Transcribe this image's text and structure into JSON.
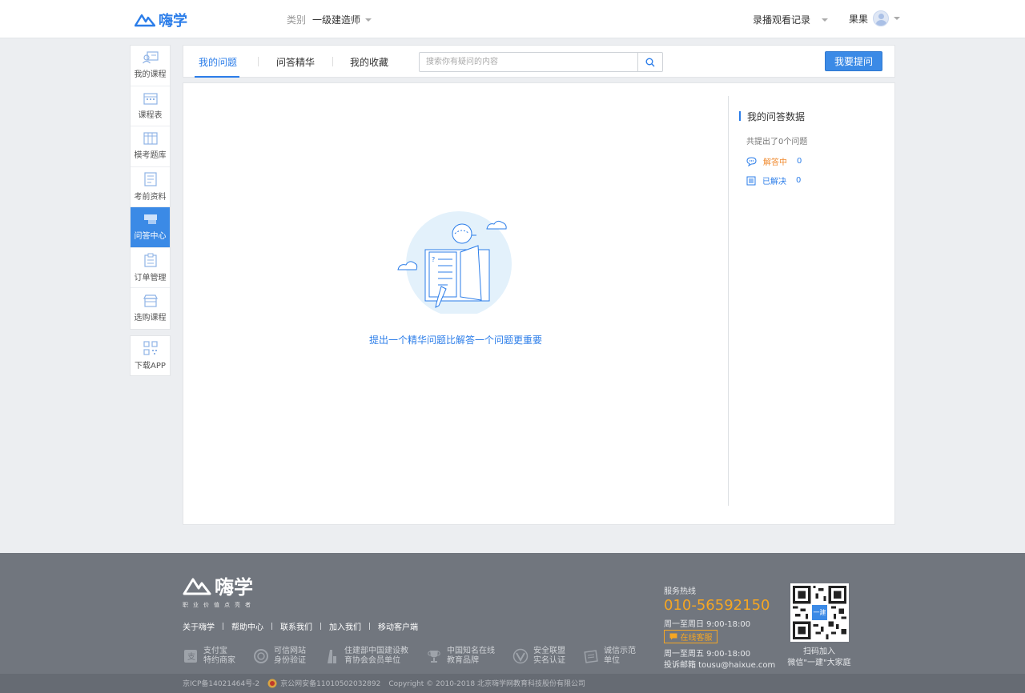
{
  "header": {
    "logo_text": "嗨学",
    "category_label": "类别",
    "category_value": "一级建造师",
    "record_label": "录播观看记录",
    "username": "果果"
  },
  "sidebar": {
    "items": [
      {
        "label": "我的课程",
        "icon": "user-course-icon"
      },
      {
        "label": "课程表",
        "icon": "calendar-icon"
      },
      {
        "label": "模考题库",
        "icon": "question-bank-icon"
      },
      {
        "label": "考前资料",
        "icon": "document-icon"
      },
      {
        "label": "问答中心",
        "icon": "qa-icon",
        "active": true
      },
      {
        "label": "订单管理",
        "icon": "clipboard-icon"
      },
      {
        "label": "选购课程",
        "icon": "shop-icon"
      }
    ],
    "download": {
      "label": "下载APP",
      "icon": "qrcode-icon"
    }
  },
  "tabs": {
    "items": [
      "我的问题",
      "问答精华",
      "我的收藏"
    ],
    "active_index": 0,
    "search_placeholder": "搜索你有疑问的内容",
    "ask_button": "我要提问"
  },
  "main": {
    "empty_text": "提出一个精华问题比解答一个问题更重要",
    "stats": {
      "title": "我的问答数据",
      "total": "共提出了0个问题",
      "answering_label": "解答中",
      "answering_count": "0",
      "solved_label": "已解决",
      "solved_count": "0"
    }
  },
  "footer": {
    "logo_text": "嗨学",
    "slogan": "职业价值点亮者",
    "links": [
      "关于嗨学",
      "帮助中心",
      "联系我们",
      "加入我们",
      "移动客户端"
    ],
    "badges": [
      {
        "line1": "支付宝",
        "line2": "特约商家"
      },
      {
        "line1": "可信网站",
        "line2": "身份验证"
      },
      {
        "line1": "住建部中国建设教",
        "line2": "育协会会员单位"
      },
      {
        "line1": "中国知名在线",
        "line2": "教育品牌"
      },
      {
        "line1": "安全联盟",
        "line2": "实名认证"
      },
      {
        "line1": "诚信示范",
        "line2": "单位"
      }
    ],
    "hotline_label": "服务热线",
    "hotline_number": "010-56592150",
    "hours_weekend": "周一至周日 9:00-18:00",
    "online_service": "在线客服",
    "hours_weekday": "周一至周五 9:00-18:00",
    "email": "投诉邮箱 tousu@haixue.com",
    "qr_center": "一建",
    "qr_caption_1": "扫码加入",
    "qr_caption_2": "微信\"一建\"大家庭",
    "icp": "京ICP备14021464号-2",
    "police": "京公网安备11010502032892",
    "copyright": "Copyright © 2010-2018 北京嗨学网教育科技股份有限公司"
  },
  "colors": {
    "primary": "#2b7de9",
    "sidebar_active": "#3b8ae6",
    "accent_orange": "#f5a623",
    "footer_bg": "#71767e"
  }
}
